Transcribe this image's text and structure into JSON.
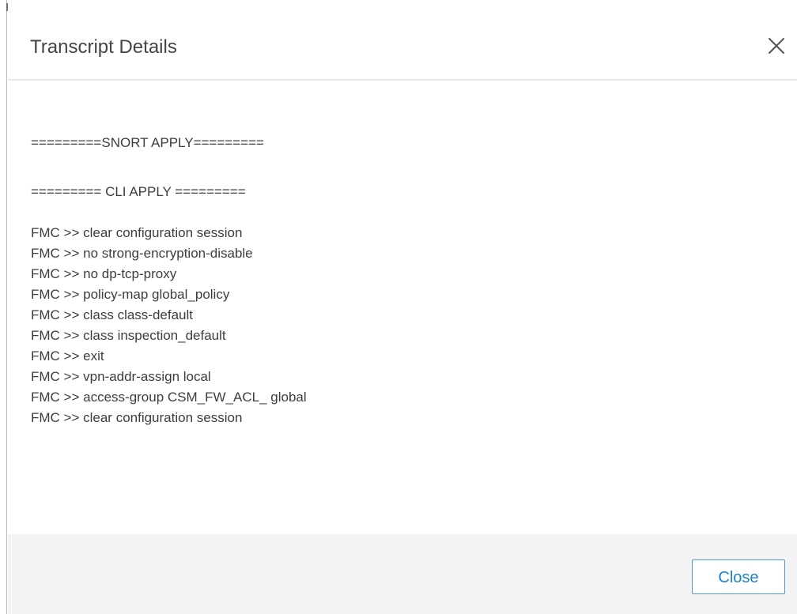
{
  "dialog": {
    "title": "Transcript Details",
    "close_icon": "close-icon",
    "close_button_label": "Close"
  },
  "transcript": {
    "snort_apply": "=========SNORT APPLY=========",
    "cli_apply": "========= CLI APPLY =========",
    "commands": [
      "FMC >> clear configuration session",
      "FMC >> no strong-encryption-disable",
      "FMC >> no dp-tcp-proxy",
      "FMC >> policy-map global_policy",
      "FMC >> class class-default",
      "FMC >> class inspection_default",
      "FMC >> exit",
      "FMC >> vpn-addr-assign local",
      "FMC >> access-group CSM_FW_ACL_ global",
      "FMC >> clear configuration session"
    ]
  },
  "colors": {
    "accent": "#1d82c8",
    "footer_bg": "#f3f3f3",
    "text": "#3d3d3d"
  }
}
